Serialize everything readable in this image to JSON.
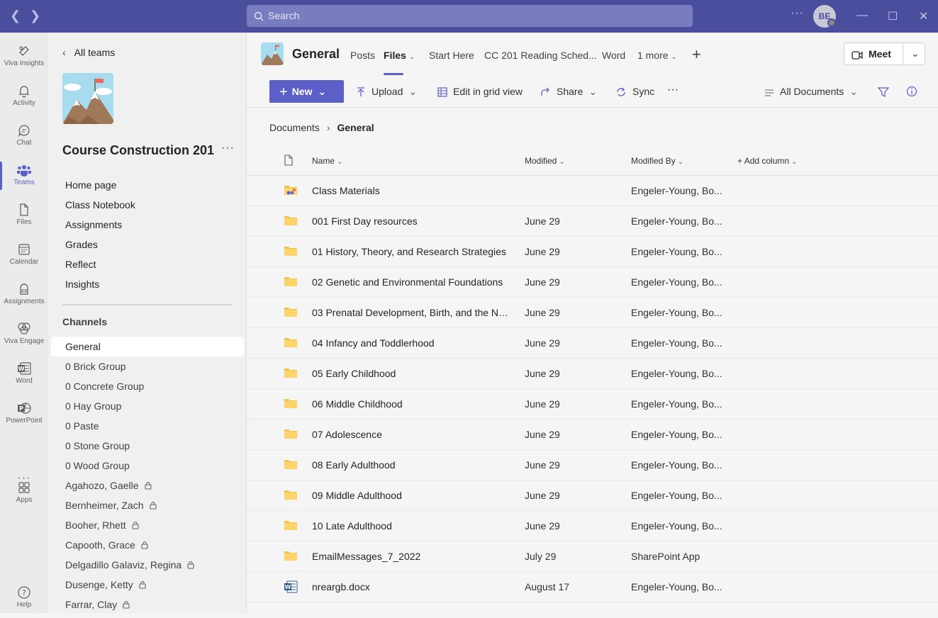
{
  "titlebar": {
    "search_placeholder": "Search",
    "avatar_initials": "BE"
  },
  "rail": {
    "items": [
      {
        "label": "Viva Insights",
        "icon": "viva-insights-icon"
      },
      {
        "label": "Activity",
        "icon": "bell-icon"
      },
      {
        "label": "Chat",
        "icon": "chat-icon"
      },
      {
        "label": "Teams",
        "icon": "teams-icon"
      },
      {
        "label": "Files",
        "icon": "file-icon"
      },
      {
        "label": "Calendar",
        "icon": "calendar-icon"
      },
      {
        "label": "Assignments",
        "icon": "backpack-icon"
      },
      {
        "label": "Viva Engage",
        "icon": "viva-engage-icon"
      },
      {
        "label": "Word",
        "icon": "word-icon"
      },
      {
        "label": "PowerPoint",
        "icon": "powerpoint-icon"
      },
      {
        "label": "Apps",
        "icon": "apps-icon"
      },
      {
        "label": "Help",
        "icon": "help-icon"
      }
    ],
    "more": "···",
    "accent": "#5b5fc7"
  },
  "team": {
    "back_label": "All teams",
    "name": "Course Construction 201",
    "more": "···",
    "links": [
      "Home page",
      "Class Notebook",
      "Assignments",
      "Grades",
      "Reflect",
      "Insights"
    ],
    "channels_header": "Channels",
    "channels": [
      {
        "name": "General",
        "locked": false
      },
      {
        "name": "0 Brick Group",
        "locked": false
      },
      {
        "name": "0 Concrete Group",
        "locked": false
      },
      {
        "name": "0 Hay Group",
        "locked": false
      },
      {
        "name": "0 Paste",
        "locked": false
      },
      {
        "name": "0 Stone Group",
        "locked": false
      },
      {
        "name": "0 Wood Group",
        "locked": false
      },
      {
        "name": "Agahozo, Gaelle",
        "locked": true
      },
      {
        "name": "Bernheimer, Zach",
        "locked": true
      },
      {
        "name": "Booher, Rhett",
        "locked": true
      },
      {
        "name": "Capooth, Grace",
        "locked": true
      },
      {
        "name": "Delgadillo Galaviz, Regina",
        "locked": true
      },
      {
        "name": "Dusenge, Ketty",
        "locked": true
      },
      {
        "name": "Farrar, Clay",
        "locked": true
      }
    ]
  },
  "channel": {
    "title": "General",
    "tabs": [
      "Posts",
      "Files",
      "Start Here",
      "CC 201 Reading Sched...",
      "Word",
      "1 more"
    ],
    "meet_label": "Meet"
  },
  "commands": {
    "new": "New",
    "upload": "Upload",
    "grid": "Edit in grid view",
    "share": "Share",
    "sync": "Sync",
    "more": "···",
    "view": "All Documents"
  },
  "breadcrumb": {
    "root": "Documents",
    "current": "General"
  },
  "table": {
    "headers": {
      "name": "Name",
      "modified": "Modified",
      "modified_by": "Modified By",
      "add_column": "Add column"
    },
    "rows": [
      {
        "name": "Class Materials",
        "modified": "",
        "by": "Engeler-Young, Bo...",
        "icon": "class-folder-icon"
      },
      {
        "name": "001 First Day resources",
        "modified": "June 29",
        "by": "Engeler-Young, Bo...",
        "icon": "folder-icon"
      },
      {
        "name": "01 History, Theory, and Research Strategies",
        "modified": "June 29",
        "by": "Engeler-Young, Bo...",
        "icon": "folder-icon"
      },
      {
        "name": "02 Genetic and Environmental Foundations",
        "modified": "June 29",
        "by": "Engeler-Young, Bo...",
        "icon": "folder-icon"
      },
      {
        "name": "03 Prenatal Development, Birth, and the Ne...",
        "modified": "June 29",
        "by": "Engeler-Young, Bo...",
        "icon": "folder-icon"
      },
      {
        "name": "04 Infancy and Toddlerhood",
        "modified": "June 29",
        "by": "Engeler-Young, Bo...",
        "icon": "folder-icon"
      },
      {
        "name": "05 Early Childhood",
        "modified": "June 29",
        "by": "Engeler-Young, Bo...",
        "icon": "folder-icon"
      },
      {
        "name": "06 Middle Childhood",
        "modified": "June 29",
        "by": "Engeler-Young, Bo...",
        "icon": "folder-icon"
      },
      {
        "name": "07 Adolescence",
        "modified": "June 29",
        "by": "Engeler-Young, Bo...",
        "icon": "folder-icon"
      },
      {
        "name": "08 Early Adulthood",
        "modified": "June 29",
        "by": "Engeler-Young, Bo...",
        "icon": "folder-icon"
      },
      {
        "name": "09 Middle Adulthood",
        "modified": "June 29",
        "by": "Engeler-Young, Bo...",
        "icon": "folder-icon"
      },
      {
        "name": "10 Late Adulthood",
        "modified": "June 29",
        "by": "Engeler-Young, Bo...",
        "icon": "folder-icon"
      },
      {
        "name": "EmailMessages_7_2022",
        "modified": "July 29",
        "by": "SharePoint App",
        "icon": "folder-icon"
      },
      {
        "name": "nreargb.docx",
        "modified": "August 17",
        "by": "Engeler-Young, Bo...",
        "icon": "word-doc-icon"
      }
    ]
  }
}
